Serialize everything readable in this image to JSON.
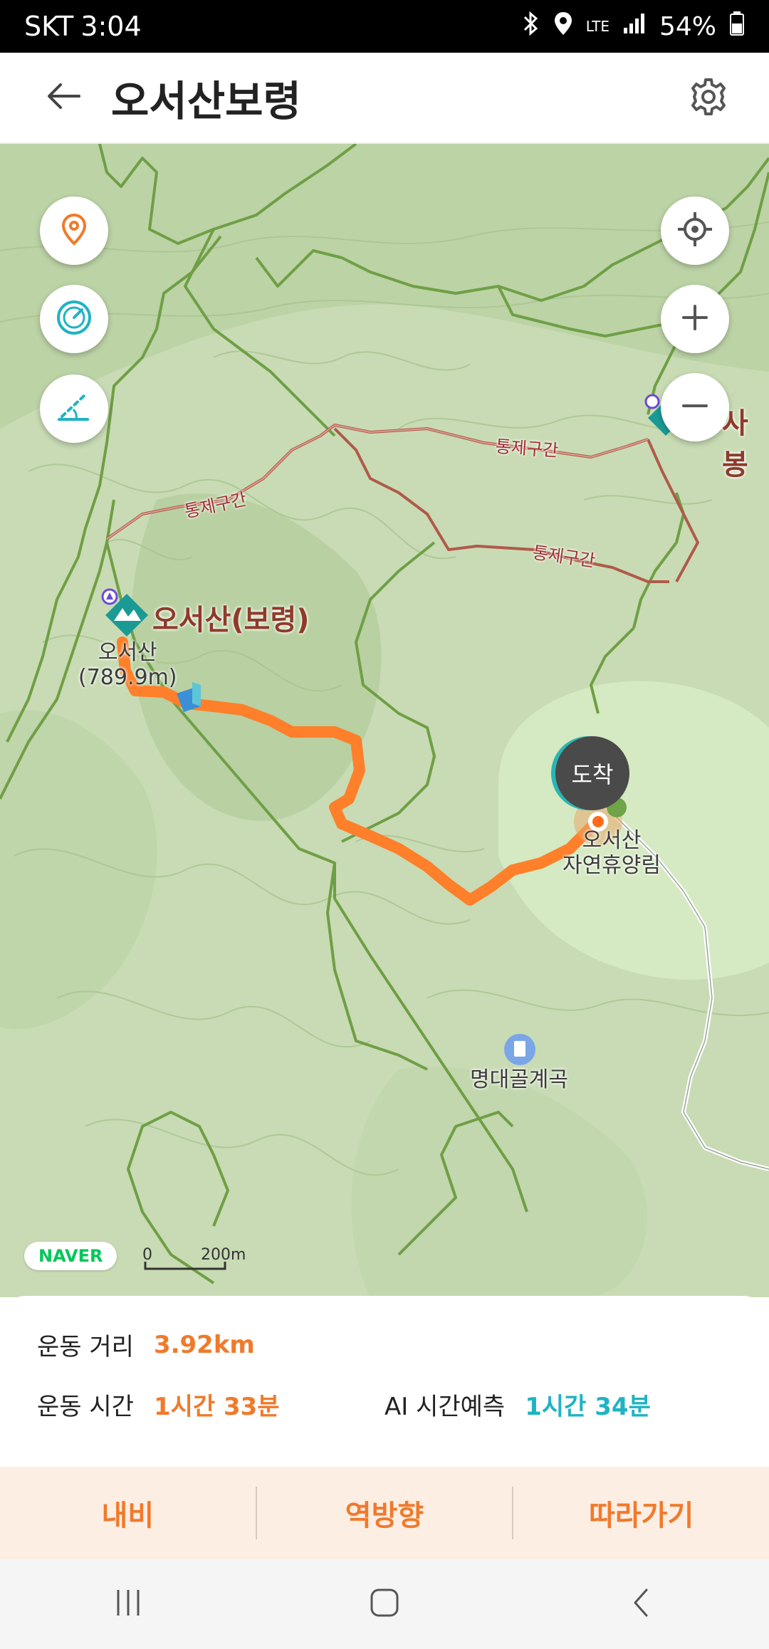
{
  "status_bar": {
    "carrier": "SKT",
    "time": "3:04",
    "network": "LTE",
    "battery": "54%"
  },
  "header": {
    "title": "오서산보령",
    "back_icon": "arrow-left-icon",
    "settings_icon": "gear-icon"
  },
  "map": {
    "peak_title": "오서산(보령)",
    "peak_sub": "오서산\n(789.9m)",
    "destination_label": "도착",
    "forest_label": "오서산\n자연휴양림",
    "valley_label": "명대골계곡",
    "restricted_label": "통제구간",
    "right_edge_label": "사봉",
    "brand": "NAVER",
    "scale_zero": "0",
    "scale_distance": "200m"
  },
  "stats": {
    "distance_label": "운동 거리",
    "distance_value": "3.92km",
    "time_label": "운동 시간",
    "time_value": "1시간 33분",
    "ai_label": "AI 시간예측",
    "ai_value": "1시간 34분"
  },
  "actions": {
    "navi": "내비",
    "reverse": "역방향",
    "follow": "따라가기"
  },
  "colors": {
    "accent": "#f07a2b",
    "teal": "#1fb3c3",
    "route": "#ff7f2a"
  }
}
